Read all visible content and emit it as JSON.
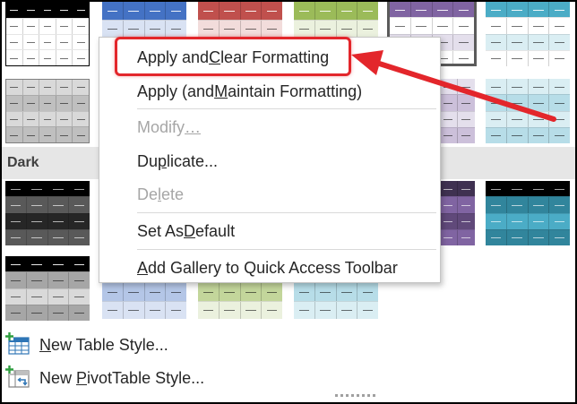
{
  "gallery": {
    "section_dark_label": "Dark",
    "colors": {
      "black": "#000000",
      "blue": "#4472c4",
      "red": "#c0504d",
      "green": "#9bbb59",
      "purple": "#8064a2",
      "teal": "#4bacc6",
      "gray": "#7f7f7f"
    }
  },
  "context_menu": {
    "items": [
      {
        "pre": "Apply and ",
        "key": "C",
        "post": "lear Formatting",
        "disabled": false
      },
      {
        "pre": "Apply (and ",
        "key": "M",
        "post": "aintain Formatting)",
        "disabled": false
      },
      {
        "pre": "Modify",
        "key": "…",
        "post": "",
        "disabled": true
      },
      {
        "pre": "Du",
        "key": "p",
        "post": "licate...",
        "disabled": false
      },
      {
        "pre": "De",
        "key": "l",
        "post": "ete",
        "disabled": true
      },
      {
        "pre": "Set As ",
        "key": "D",
        "post": "efault",
        "disabled": false
      },
      {
        "pre": "",
        "key": "A",
        "post": "dd Gallery to Quick Access Toolbar",
        "disabled": false
      }
    ]
  },
  "commands": {
    "new_table_style": {
      "pre": "",
      "key": "N",
      "post": "ew Table Style..."
    },
    "new_pivot_style": {
      "pre": "New ",
      "key": "P",
      "post": "ivotTable Style..."
    }
  },
  "annotation": {
    "color": "#e3262b"
  }
}
